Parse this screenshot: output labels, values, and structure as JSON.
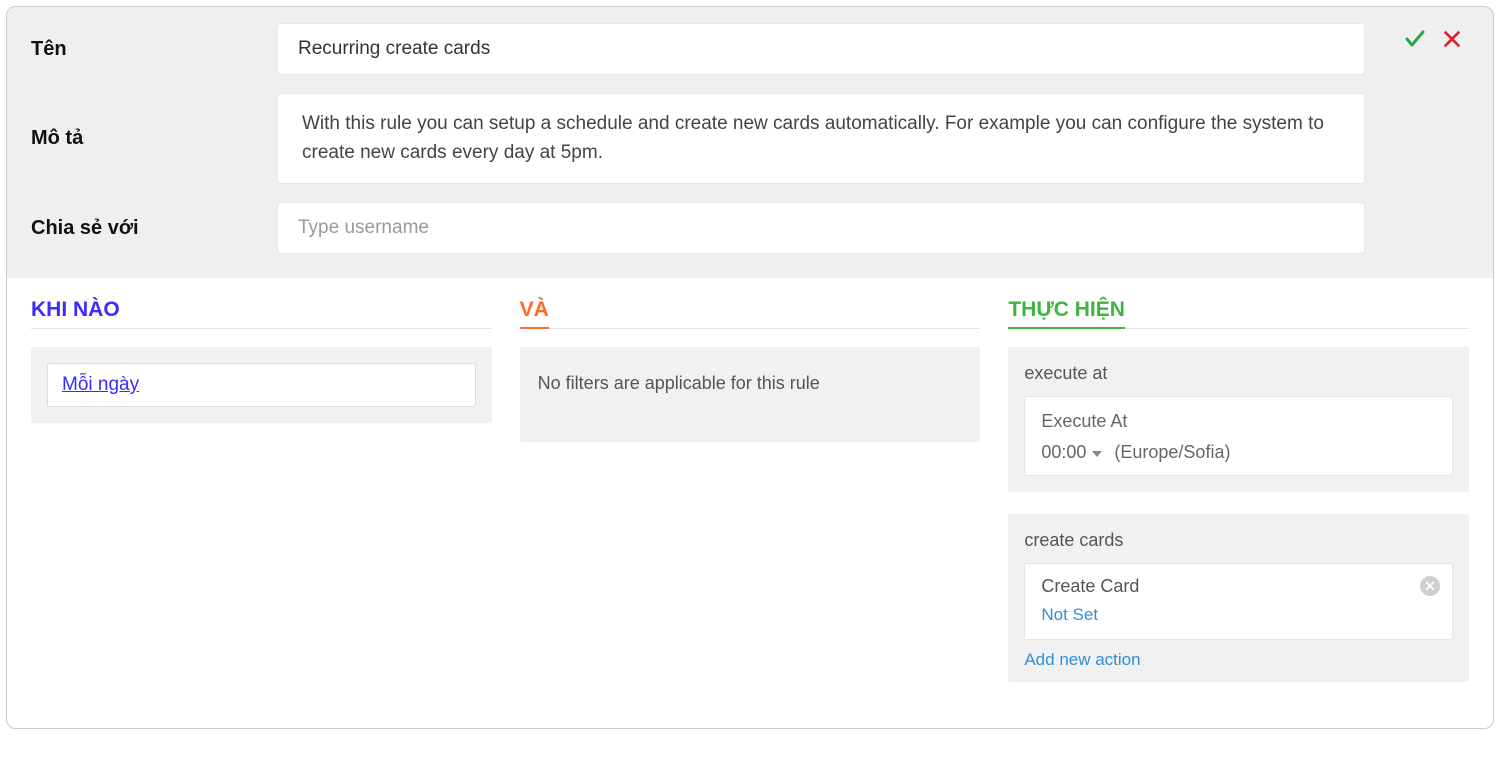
{
  "header": {
    "labels": {
      "name": "Tên",
      "description": "Mô tả",
      "share": "Chia sẻ với"
    },
    "name_value": "Recurring create cards",
    "description_value": "With this rule you can setup a schedule and create new cards automatically. For example you can configure the system to create new cards every day at 5pm.",
    "share_placeholder": "Type username"
  },
  "columns": {
    "when": {
      "title": "KHI NÀO",
      "trigger_label": "Mỗi ngày"
    },
    "and": {
      "title": "VÀ",
      "message": "No filters are applicable for this rule"
    },
    "do": {
      "title": "THỰC HIỆN",
      "execute": {
        "section_label": "execute at",
        "box_title": "Execute At",
        "time": "00:00",
        "tz": "(Europe/Sofia)"
      },
      "create": {
        "section_label": "create cards",
        "item_title": "Create Card",
        "item_value": "Not Set",
        "add_label": "Add new action"
      }
    }
  }
}
